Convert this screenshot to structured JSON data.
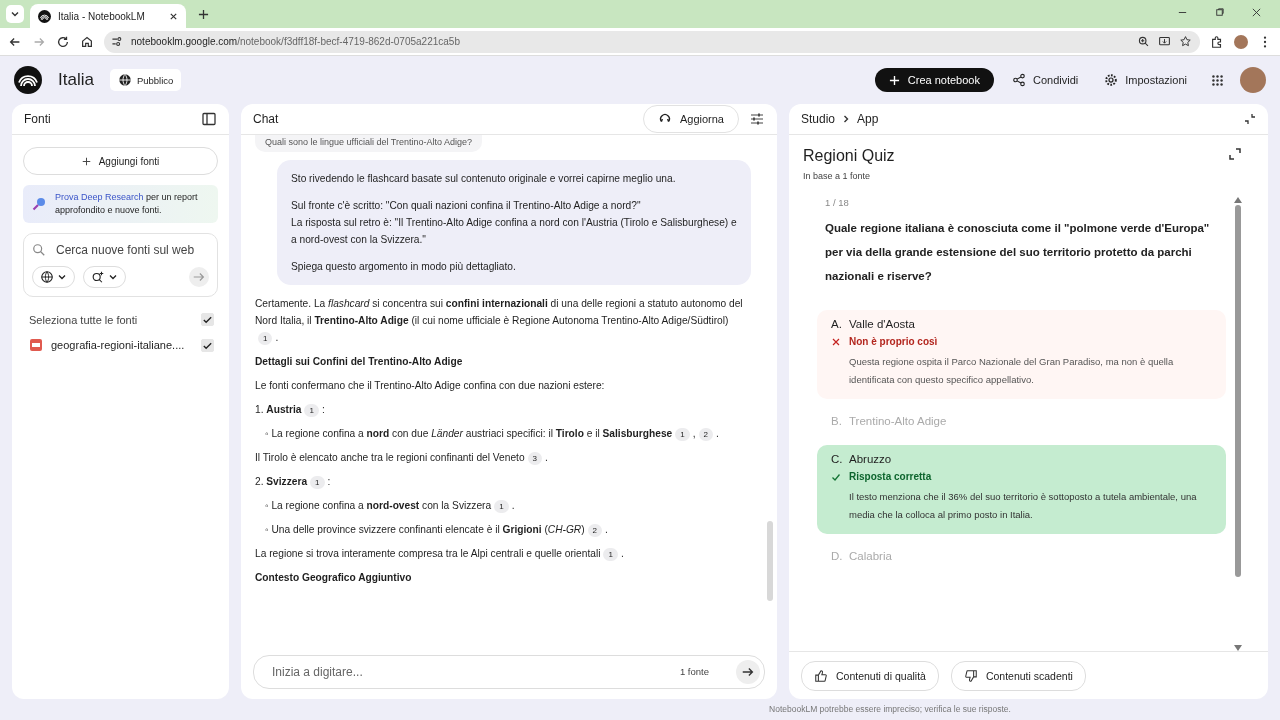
{
  "browser": {
    "tab_title": "Italia - NotebookLM",
    "url_host": "notebooklm.google.com",
    "url_path": "/notebook/f3dff18f-becf-4719-862d-0705a221ca5b"
  },
  "header": {
    "title": "Italia",
    "visibility": "Pubblico",
    "create_button": "Crea notebook",
    "share_button": "Condividi",
    "settings_button": "Impostazioni"
  },
  "sources": {
    "title": "Fonti",
    "add_button": "Aggiungi fonti",
    "promo_link": "Prova Deep Research",
    "promo_text": "per un report approfondito e nuove fonti.",
    "search": {
      "placeholder": "Cerca nuove fonti sul web"
    },
    "select_all": {
      "label": "Seleziona tutte le fonti",
      "checked": true
    },
    "items": [
      {
        "name": "geografia-regioni-italiane....",
        "checked": true
      }
    ]
  },
  "chat": {
    "title": "Chat",
    "refresh_button": "Aggiorna",
    "previous_question": "Quali sono le lingue ufficiali del Trentino-Alto Adige?",
    "user_message": [
      "Sto rivedendo le flashcard basate sul contenuto originale e vorrei capirne meglio una.",
      "Sul fronte c'è scritto: \"Con quali nazioni confina il Trentino-Alto Adige a nord?\"\nLa risposta sul retro è: \"Il Trentino-Alto Adige confina a nord con l'Austria (Tirolo e Salisburghese) e a nord-ovest con la Svizzera.\"",
      "Spiega questo argomento in modo più dettagliato."
    ],
    "answer": [
      {
        "kind": "para",
        "parts": [
          {
            "kind": "text",
            "text": "Certamente. La *flashcard* si concentra sui **confini internazionali** di una delle regioni a statuto autonomo del Nord Italia, il **Trentino-Alto Adige** (il cui nome ufficiale è Regione Autonoma Trentino-Alto Adige/Südtirol)"
          },
          {
            "kind": "cite",
            "text": "1"
          },
          {
            "kind": "text",
            "text": "."
          }
        ]
      },
      {
        "kind": "heading",
        "parts": [
          {
            "kind": "text",
            "text": "Dettagli sui Confini del Trentino-Alto Adige"
          }
        ]
      },
      {
        "kind": "para",
        "parts": [
          {
            "kind": "text",
            "text": "Le fonti confermano che il Trentino-Alto Adige confina con due nazioni estere:"
          }
        ]
      },
      {
        "kind": "para",
        "parts": [
          {
            "kind": "text",
            "text": "1. **Austria**"
          },
          {
            "kind": "cite",
            "text": "1"
          },
          {
            "kind": "text",
            "text": ":"
          }
        ]
      },
      {
        "kind": "bullet",
        "parts": [
          {
            "kind": "text",
            "text": "◦ La regione confina a **nord** con due *Länder* austriaci specifici: il **Tirolo** e il **Salisburghese**"
          },
          {
            "kind": "cite",
            "text": "1"
          },
          {
            "kind": "text",
            "text": ","
          },
          {
            "kind": "cite",
            "text": "2"
          },
          {
            "kind": "text",
            "text": "."
          }
        ]
      },
      {
        "kind": "para",
        "parts": [
          {
            "kind": "text",
            "text": "Il Tirolo è elencato anche tra le regioni confinanti del Veneto"
          },
          {
            "kind": "cite",
            "text": "3"
          },
          {
            "kind": "text",
            "text": "."
          }
        ]
      },
      {
        "kind": "para",
        "parts": [
          {
            "kind": "text",
            "text": "2. **Svizzera**"
          },
          {
            "kind": "cite",
            "text": "1"
          },
          {
            "kind": "text",
            "text": ":"
          }
        ]
      },
      {
        "kind": "bullet",
        "parts": [
          {
            "kind": "text",
            "text": "◦ La regione confina a **nord-ovest** con la Svizzera"
          },
          {
            "kind": "cite",
            "text": "1"
          },
          {
            "kind": "text",
            "text": "."
          }
        ]
      },
      {
        "kind": "bullet",
        "parts": [
          {
            "kind": "text",
            "text": "◦ Una delle province svizzere confinanti elencate è il **Grigioni** (*CH-GR*)"
          },
          {
            "kind": "cite",
            "text": "2"
          },
          {
            "kind": "text",
            "text": "."
          }
        ]
      },
      {
        "kind": "para",
        "parts": [
          {
            "kind": "text",
            "text": "La regione si trova interamente compresa tra le Alpi centrali e quelle orientali"
          },
          {
            "kind": "cite",
            "text": "1"
          },
          {
            "kind": "text",
            "text": "."
          }
        ]
      },
      {
        "kind": "heading",
        "parts": [
          {
            "kind": "text",
            "text": "Contesto Geografico Aggiuntivo"
          }
        ]
      }
    ],
    "input": {
      "placeholder": "Inizia a digitare...",
      "source_count": "1 fonte"
    },
    "disclaimer": "NotebookLM potrebbe essere impreciso; verifica le sue risposte."
  },
  "studio": {
    "breadcrumb": [
      "Studio",
      "App"
    ],
    "title": "Regioni Quiz",
    "subtitle": "In base a 1 fonte",
    "progress": "1 / 18",
    "question": "Quale regione italiana è conosciuta come il \"polmone verde d'Europa\" per via della grande estensione del suo territorio protetto da parchi nazionali e riserve?",
    "options": [
      {
        "letter": "A.",
        "label": "Valle d'Aosta",
        "kind": "wrong",
        "disabled": false,
        "feedback": "Non è proprio così",
        "explanation": "Questa regione ospita il Parco Nazionale del Gran Paradiso, ma non è quella identificata con questo specifico appellativo."
      },
      {
        "letter": "B.",
        "label": "Trentino-Alto Adige",
        "kind": "plain",
        "disabled": true
      },
      {
        "letter": "C.",
        "label": "Abruzzo",
        "kind": "correct",
        "disabled": false,
        "feedback": "Risposta corretta",
        "explanation": "Il testo menziona che il 36% del suo territorio è sottoposto a tutela ambientale, una media che la colloca al primo posto in Italia."
      },
      {
        "letter": "D.",
        "label": "Calabria",
        "kind": "plain",
        "disabled": true
      }
    ],
    "feedback_buttons": [
      "Contenuti di qualità",
      "Contenuti scadenti"
    ]
  }
}
